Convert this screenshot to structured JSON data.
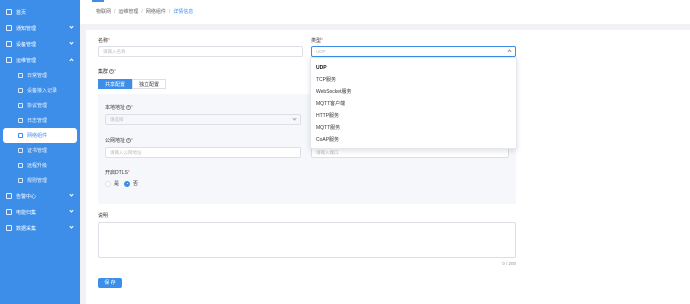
{
  "sidebar": {
    "items": [
      {
        "label": "首页"
      },
      {
        "label": "通知管理"
      },
      {
        "label": "设备管理"
      },
      {
        "label": "运维管理"
      },
      {
        "label": "告警中心"
      },
      {
        "label": "电能归集"
      },
      {
        "label": "数据采集"
      }
    ],
    "subitems": [
      {
        "label": "日常管理"
      },
      {
        "label": "设备接入记录"
      },
      {
        "label": "协议管理"
      },
      {
        "label": "日志管理"
      },
      {
        "label": "网络组件"
      },
      {
        "label": "证书管理"
      },
      {
        "label": "远程升级"
      },
      {
        "label": "规则管理"
      }
    ]
  },
  "breadcrumb": {
    "items": [
      "物联网",
      "运维管理",
      "网络组件",
      "详情信息"
    ]
  },
  "form": {
    "name_label": "名称",
    "name_placeholder": "请输入名称",
    "type_label": "类型",
    "type_value": "UDP",
    "cluster_label": "集群",
    "cluster_shared": "共享配置",
    "cluster_independent": "独立配置",
    "local_addr_label": "本地地址",
    "local_addr_placeholder": "请选择",
    "public_addr_label": "公网地址",
    "public_addr_placeholder": "请输入公网地址",
    "port_placeholder": "请输入端口",
    "dtls_label": "开启DTLS",
    "dtls_yes": "是",
    "dtls_no": "否",
    "desc_label": "说明",
    "desc_count": "0 / 200",
    "save_label": "保 存"
  },
  "dropdown": {
    "options": [
      "UDP",
      "TCP服务",
      "WebSocket服务",
      "MQTT客户端",
      "HTTP服务",
      "MQTT服务",
      "CoAP服务"
    ],
    "selected": "UDP"
  },
  "colors": {
    "accent": "#3d8ee8"
  }
}
